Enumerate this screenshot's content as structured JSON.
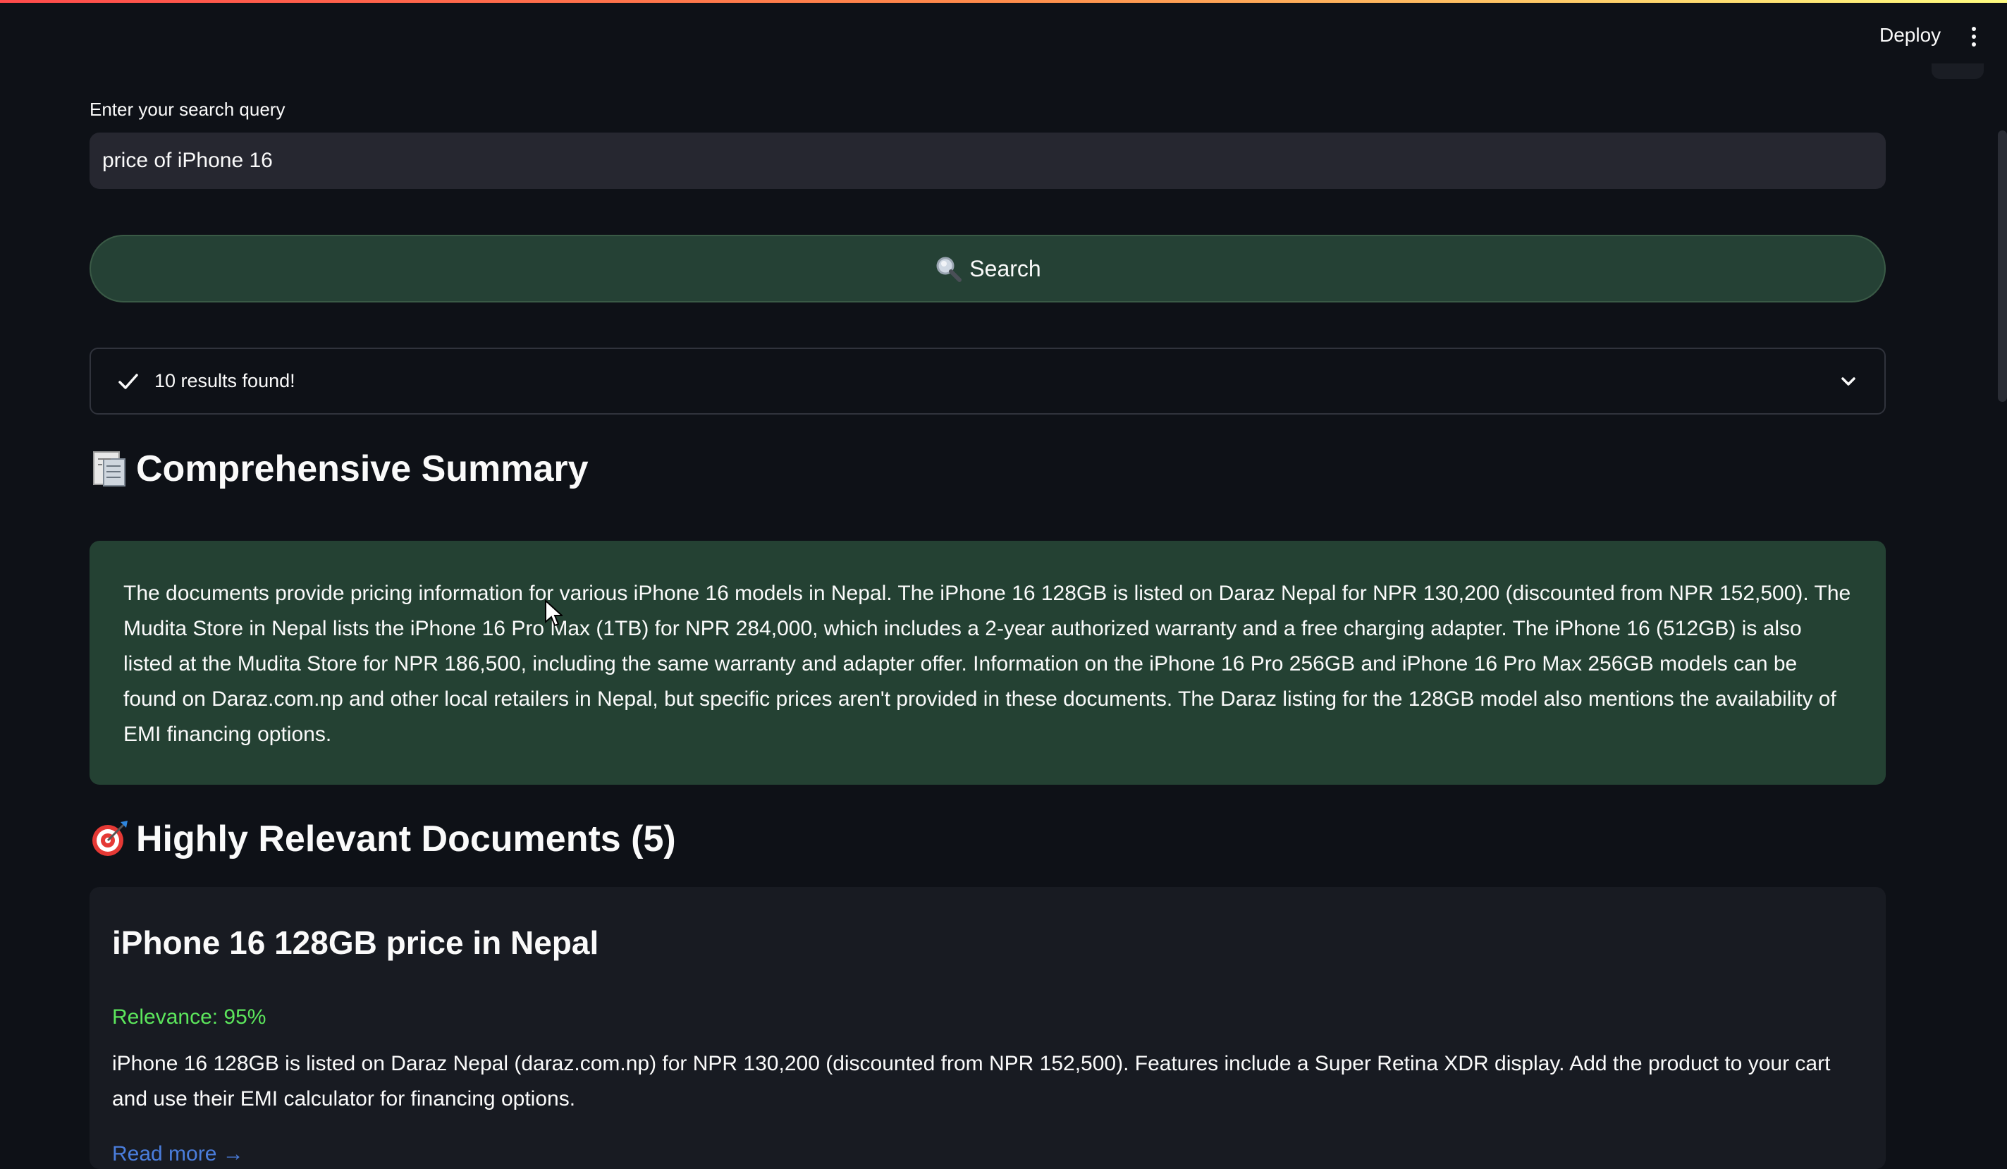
{
  "header": {
    "deploy_label": "Deploy",
    "menu_icon": "more-vertical-icon"
  },
  "search": {
    "label": "Enter your search query",
    "value": "price of iPhone 16",
    "button_label": "Search",
    "button_icon": "magnifier-icon"
  },
  "status": {
    "text": "10 results found!",
    "icon": "check-icon",
    "expand_icon": "chevron-down-icon"
  },
  "summary": {
    "heading": "Comprehensive Summary",
    "heading_icon": "document-emoji-icon",
    "text": "The documents provide pricing information for various iPhone 16 models in Nepal. The iPhone 16 128GB is listed on Daraz Nepal for NPR 130,200 (discounted from NPR 152,500). The Mudita Store in Nepal lists the iPhone 16 Pro Max (1TB) for NPR 284,000, which includes a 2-year authorized warranty and a free charging adapter. The iPhone 16 (512GB) is also listed at the Mudita Store for NPR 186,500, including the same warranty and adapter offer. Information on the iPhone 16 Pro 256GB and iPhone 16 Pro Max 256GB models can be found on Daraz.com.np and other local retailers in Nepal, but specific prices aren't provided in these documents. The Daraz listing for the 128GB model also mentions the availability of EMI financing options."
  },
  "docs": {
    "heading": "Highly Relevant Documents (5)",
    "heading_icon": "target-emoji-icon",
    "items": [
      {
        "title": "iPhone 16 128GB price in Nepal",
        "relevance": "Relevance: 95%",
        "body": "iPhone 16 128GB is listed on Daraz Nepal (daraz.com.np) for NPR 130,200 (discounted from NPR 152,500). Features include a Super Retina XDR display. Add the product to your cart and use their EMI calculator for financing options.",
        "link": "Read more →"
      }
    ]
  },
  "colors": {
    "background": "#0e1117",
    "input_bg": "#262730",
    "button_bg": "#254135",
    "summary_bg": "#244133",
    "card_bg": "#181b22",
    "relevance": "#5ce65c",
    "link": "#4a7ddc"
  }
}
